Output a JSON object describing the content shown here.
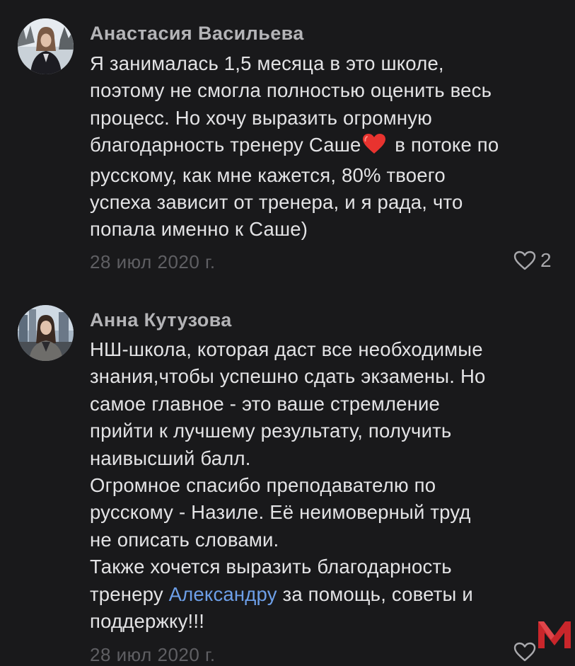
{
  "comments": [
    {
      "author": "Анастасия Васильева",
      "lines": [
        "Я занималась 1,5 месяца в это школе,",
        "поэтому не смогла полностью оценить весь",
        "процесс. Но хочу выразить огромную",
        "благодарность тренеру Саше",
        " в потоке по",
        "русскому, как мне кажется, 80% твоего",
        "успеха зависит от тренера, и я рада, что",
        "попала именно к Саше)"
      ],
      "date": "28 июл 2020 г.",
      "likes": "2",
      "emoji": "red-heart"
    },
    {
      "author": "Анна Кутузова",
      "lines": [
        "НШ-школа, которая даст все необходимые",
        "знания,чтобы успешно сдать экзамены. Но",
        "самое главное - это ваше стремление",
        "прийти к лучшему результату, получить",
        "наивысший балл.",
        "Огромное спасибо преподавателю по",
        "русскому - Назиле. Её неимоверный труд",
        "не описать словами.",
        "Также хочется выразить благодарность",
        "тренеру ",
        "Александру",
        " за помощь, советы и",
        "поддержку!!!"
      ],
      "date": "28 июл 2020 г."
    }
  ],
  "colors": {
    "background": "#19191b",
    "author": "#b4b4b7",
    "text": "#e3e3e5",
    "date": "#5f5f63",
    "mention": "#6d9fe8",
    "heart_emoji": "#e8332f",
    "watermark": "#c9262b"
  },
  "icons": [
    "like-heart-icon",
    "red-heart-emoji",
    "watermark-logo"
  ]
}
